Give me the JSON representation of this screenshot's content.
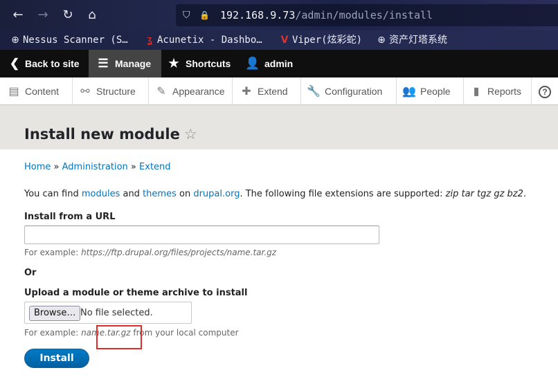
{
  "browser": {
    "back_icon": "←",
    "forward_icon": "→",
    "reload_icon": "↻",
    "home_icon": "⌂",
    "shield_icon": "⛉",
    "lock_icon": "🔒",
    "url_host": "192.168.9.73",
    "url_path": "/admin/modules/install"
  },
  "bookmarks": [
    {
      "icon": "globe-icon",
      "glyph": "⊕",
      "label": "Nessus Scanner (S…"
    },
    {
      "icon": "acunetix-icon",
      "glyph": "ʓ",
      "label": "Acunetix - Dashbo…"
    },
    {
      "icon": "viper-icon",
      "glyph": "V",
      "label": "Viper(炫彩蛇)"
    },
    {
      "icon": "globe-icon",
      "glyph": "⊕",
      "label": "资产灯塔系统"
    }
  ],
  "toolbar": {
    "back_label": "Back to site",
    "back_glyph": "❮",
    "manage_label": "Manage",
    "manage_glyph": "☰",
    "shortcuts_label": "Shortcuts",
    "shortcuts_glyph": "★",
    "user_label": "admin",
    "user_glyph": "👤"
  },
  "tray": [
    {
      "label": "Content",
      "glyph": "▤"
    },
    {
      "label": "Structure",
      "glyph": "⚯"
    },
    {
      "label": "Appearance",
      "glyph": "✎"
    },
    {
      "label": "Extend",
      "glyph": "✚"
    },
    {
      "label": "Configuration",
      "glyph": "🔧"
    },
    {
      "label": "People",
      "glyph": "👥"
    },
    {
      "label": "Reports",
      "glyph": "▮"
    },
    {
      "label": "",
      "glyph": "?"
    }
  ],
  "page": {
    "title": "Install new module",
    "star_glyph": "☆"
  },
  "breadcrumb": {
    "home": "Home",
    "administration": "Administration",
    "extend": "Extend",
    "separator": "»"
  },
  "intro": {
    "part1": "You can find ",
    "modules_link": "modules",
    "part2": " and ",
    "themes_link": "themes",
    "part3": " on ",
    "drupal_link": "drupal.org",
    "part4": ". The following file extensions are supported: ",
    "extensions": "zip tar tgz gz bz2",
    "part5": "."
  },
  "form": {
    "url_label": "Install from a URL",
    "url_value": "",
    "url_desc_prefix": "For example: ",
    "url_desc_example": "https://ftp.drupal.org/files/projects/name.tar.gz",
    "or_label": "Or",
    "upload_label": "Upload a module or theme archive to install",
    "browse_label": "Browse…",
    "no_file_label": "No file selected.",
    "upload_desc_prefix": "For example: ",
    "upload_desc_example": "name.tar.gz",
    "upload_desc_suffix": " from your local computer",
    "install_label": "Install"
  }
}
